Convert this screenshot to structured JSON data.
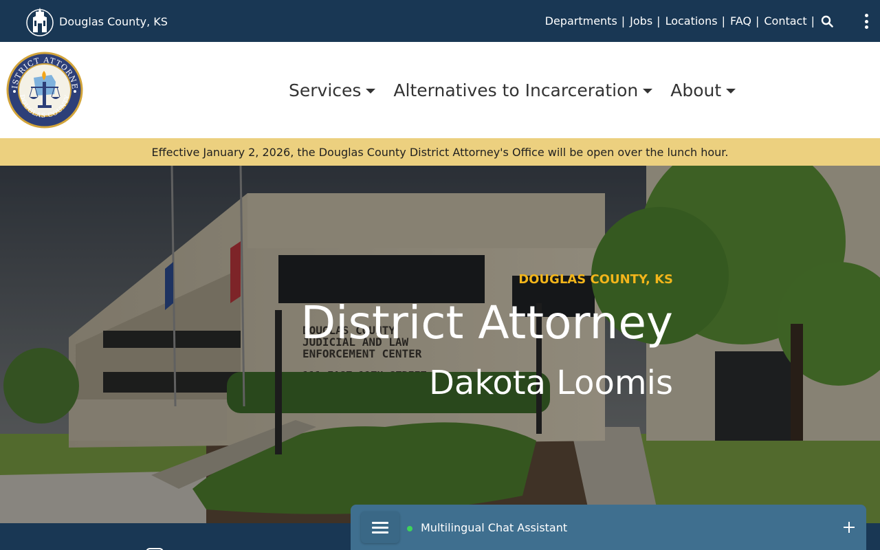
{
  "topbar": {
    "brand_text": "Douglas County, KS",
    "links": [
      {
        "label": "Departments"
      },
      {
        "label": "Jobs"
      },
      {
        "label": "Locations"
      },
      {
        "label": "FAQ"
      },
      {
        "label": "Contact"
      }
    ],
    "separator": "|",
    "search_icon": "search-icon",
    "menu_icon": "kebab-menu-icon"
  },
  "header": {
    "seal_text_top": "DISTRICT ATTORNEY",
    "seal_text_bottom": "DOUGLAS COUNTY",
    "nav": [
      {
        "label": "Services"
      },
      {
        "label": "Alternatives to Incarceration"
      },
      {
        "label": "About"
      }
    ]
  },
  "alert": {
    "text": "Effective January 2, 2026, the Douglas County District Attorney's Office will be open over the lunch hour."
  },
  "hero": {
    "kicker": "DOUGLAS COUNTY, KS",
    "title": "District Attorney",
    "subtitle": "Dakota Loomis",
    "building_sign": [
      "DOUGLAS COUNTY",
      "JUDICIAL AND LAW",
      "ENFORCEMENT CENTER",
      "111 EAST 11TH STREET"
    ]
  },
  "chat": {
    "title": "Multilingual Chat Assistant",
    "status_color": "#3ed35a"
  },
  "colors": {
    "navy": "#193754",
    "alert": "#ecd07f",
    "kicker": "#f2b51b",
    "chat": "#3f6f8f"
  }
}
